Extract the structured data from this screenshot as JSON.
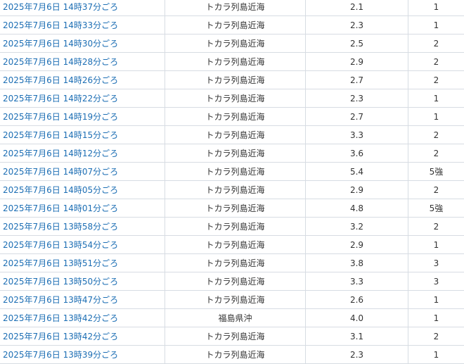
{
  "earthquakes": [
    {
      "time": "2025年7月6日 14時37分ごろ",
      "place": "トカラ列島近海",
      "magnitude": "2.1",
      "intensity": "1"
    },
    {
      "time": "2025年7月6日 14時33分ごろ",
      "place": "トカラ列島近海",
      "magnitude": "2.3",
      "intensity": "1"
    },
    {
      "time": "2025年7月6日 14時30分ごろ",
      "place": "トカラ列島近海",
      "magnitude": "2.5",
      "intensity": "2"
    },
    {
      "time": "2025年7月6日 14時28分ごろ",
      "place": "トカラ列島近海",
      "magnitude": "2.9",
      "intensity": "2"
    },
    {
      "time": "2025年7月6日 14時26分ごろ",
      "place": "トカラ列島近海",
      "magnitude": "2.7",
      "intensity": "2"
    },
    {
      "time": "2025年7月6日 14時22分ごろ",
      "place": "トカラ列島近海",
      "magnitude": "2.3",
      "intensity": "1"
    },
    {
      "time": "2025年7月6日 14時19分ごろ",
      "place": "トカラ列島近海",
      "magnitude": "2.7",
      "intensity": "1"
    },
    {
      "time": "2025年7月6日 14時15分ごろ",
      "place": "トカラ列島近海",
      "magnitude": "3.3",
      "intensity": "2"
    },
    {
      "time": "2025年7月6日 14時12分ごろ",
      "place": "トカラ列島近海",
      "magnitude": "3.6",
      "intensity": "2"
    },
    {
      "time": "2025年7月6日 14時07分ごろ",
      "place": "トカラ列島近海",
      "magnitude": "5.4",
      "intensity": "5強"
    },
    {
      "time": "2025年7月6日 14時05分ごろ",
      "place": "トカラ列島近海",
      "magnitude": "2.9",
      "intensity": "2"
    },
    {
      "time": "2025年7月6日 14時01分ごろ",
      "place": "トカラ列島近海",
      "magnitude": "4.8",
      "intensity": "5強"
    },
    {
      "time": "2025年7月6日 13時58分ごろ",
      "place": "トカラ列島近海",
      "magnitude": "3.2",
      "intensity": "2"
    },
    {
      "time": "2025年7月6日 13時54分ごろ",
      "place": "トカラ列島近海",
      "magnitude": "2.9",
      "intensity": "1"
    },
    {
      "time": "2025年7月6日 13時51分ごろ",
      "place": "トカラ列島近海",
      "magnitude": "3.8",
      "intensity": "3"
    },
    {
      "time": "2025年7月6日 13時50分ごろ",
      "place": "トカラ列島近海",
      "magnitude": "3.3",
      "intensity": "3"
    },
    {
      "time": "2025年7月6日 13時47分ごろ",
      "place": "トカラ列島近海",
      "magnitude": "2.6",
      "intensity": "1"
    },
    {
      "time": "2025年7月6日 13時42分ごろ",
      "place": "福島県沖",
      "magnitude": "4.0",
      "intensity": "1"
    },
    {
      "time": "2025年7月6日 13時42分ごろ",
      "place": "トカラ列島近海",
      "magnitude": "3.1",
      "intensity": "2"
    },
    {
      "time": "2025年7月6日 13時39分ごろ",
      "place": "トカラ列島近海",
      "magnitude": "2.3",
      "intensity": "1"
    }
  ],
  "colors": {
    "link": "#1c6eb4",
    "text": "#333333",
    "border": "#d7dce3"
  }
}
